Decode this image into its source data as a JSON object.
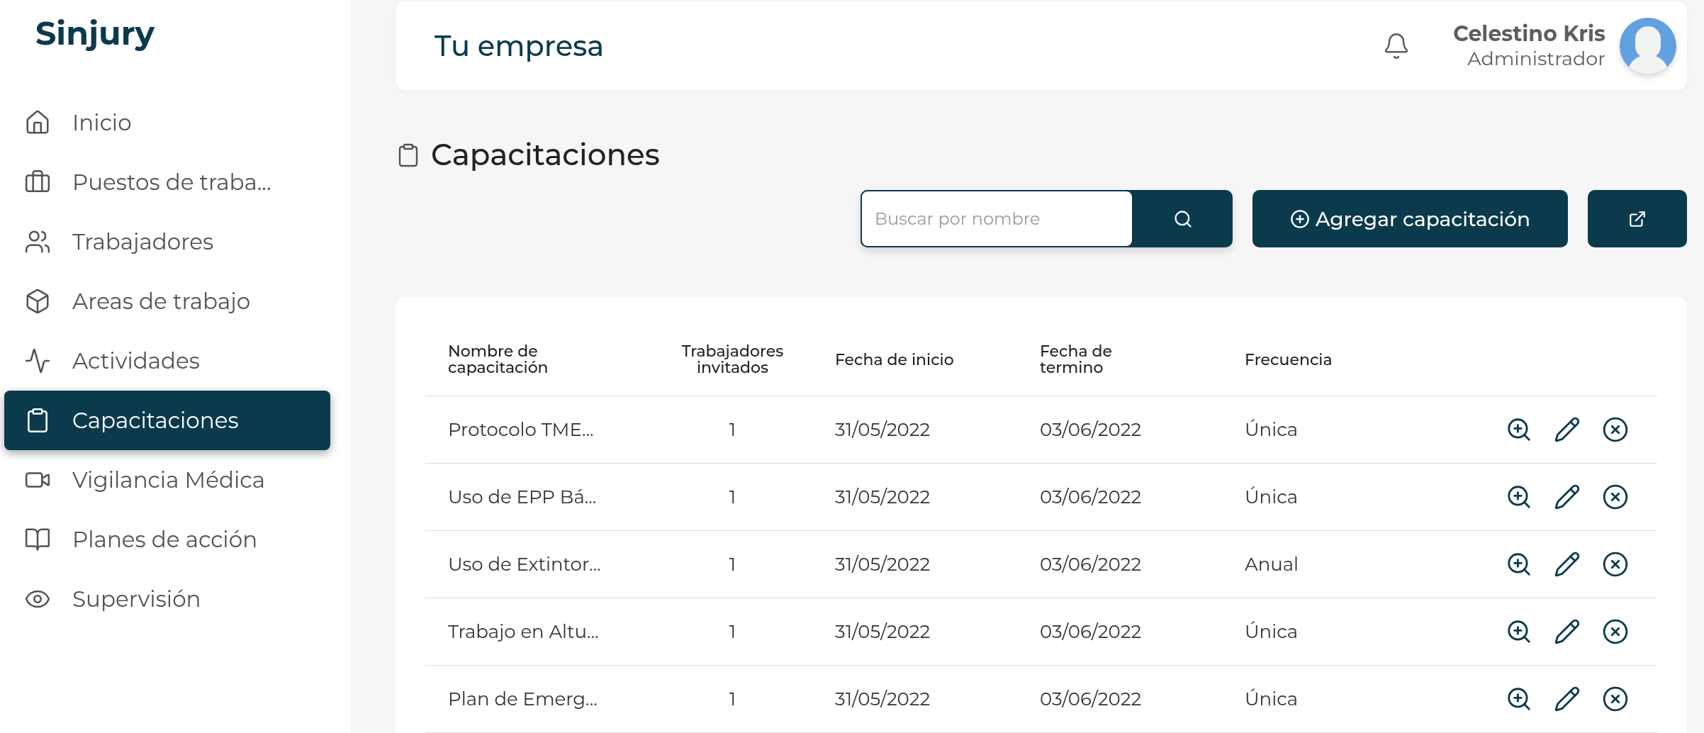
{
  "sidebar": {
    "logo": "Sinjury",
    "items": [
      {
        "label": "Inicio",
        "selected": false
      },
      {
        "label": "Puestos de traba...",
        "selected": false
      },
      {
        "label": "Trabajadores",
        "selected": false
      },
      {
        "label": "Areas de trabajo",
        "selected": false
      },
      {
        "label": "Actividades",
        "selected": false
      },
      {
        "label": "Capacitaciones",
        "selected": true
      },
      {
        "label": "Vigilancia Médica",
        "selected": false
      },
      {
        "label": "Planes de acción",
        "selected": false
      },
      {
        "label": "Supervisión",
        "selected": false
      }
    ]
  },
  "header": {
    "title": "Tu empresa",
    "user": {
      "name": "Celestino Kris",
      "role": "Administrador"
    }
  },
  "page": {
    "title": "Capacitaciones",
    "search": {
      "placeholder": "Buscar por nombre"
    },
    "add_button": "Agregar capacitación"
  },
  "table": {
    "columns": [
      "Nombre de capacitación",
      "Trabajadores invitados",
      "Fecha de inicio",
      "Fecha de termino",
      "Frecuencia"
    ],
    "rows": [
      [
        "Protocolo TME...",
        "1",
        "31/05/2022",
        "03/06/2022",
        "Única"
      ],
      [
        "Uso de EPP Bá...",
        "1",
        "31/05/2022",
        "03/06/2022",
        "Única"
      ],
      [
        "Uso de Extintor...",
        "1",
        "31/05/2022",
        "03/06/2022",
        "Anual"
      ],
      [
        "Trabajo en Altu...",
        "1",
        "31/05/2022",
        "03/06/2022",
        "Única"
      ],
      [
        "Plan de Emerg...",
        "1",
        "31/05/2022",
        "03/06/2022",
        "Única"
      ]
    ]
  }
}
